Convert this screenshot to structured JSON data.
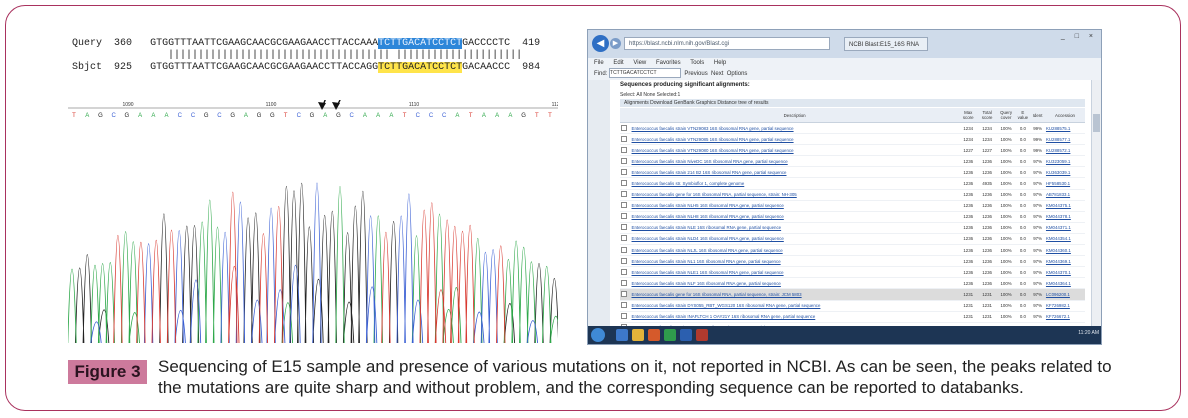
{
  "alignment": {
    "query_label": "Query",
    "query_start": "360",
    "query_seq_a": "GTGGTTTAATTCGAAGCAACGCGAAGAACCTTACCAAA",
    "query_seq_hl": "TCTTGACATCCTCT",
    "query_seq_b": "GACCCCTC",
    "query_end": "419",
    "match_line": "||||||||||||||||||||||||||||||||||||| |||||||||||||||||||||",
    "sbjct_label": "Sbjct",
    "sbjct_start": "925",
    "sbjct_seq_a": "GTGGTTTAATTCGAAGCAACGCGAAGAACCTTACCAGG",
    "sbjct_seq_hl": "TCTTGACATCCTCT",
    "sbjct_seq_b": "GACAACCC",
    "sbjct_end": "984"
  },
  "chromatogram": {
    "positions": [
      "1090",
      "1100",
      "1110",
      "1120"
    ],
    "bases": "TAGCGAAACCGCGAGGTCGAGCAAATCCCATAAAGTT",
    "base_colors": {
      "A": "#2ea84a",
      "C": "#3a5fd4",
      "G": "#222222",
      "T": "#d8382f"
    }
  },
  "browser": {
    "url": "https://blast.ncbi.nlm.nih.gov/Blast.cgi",
    "tab": "NCBI Blast:E15_16S RNA",
    "window_controls": "_ □ ×",
    "menu": [
      "File",
      "Edit",
      "View",
      "Favorites",
      "Tools",
      "Help"
    ],
    "find_label": "Find:",
    "find_value": "TCTTGACATCCTCT",
    "find_prev": "Previous",
    "find_next": "Next",
    "find_options": "Options",
    "section_title": "Sequences producing significant alignments:",
    "select_line": "Select: All None  Selected:1",
    "toolbar": "Alignments  Download  GenBank  Graphics  Distance tree of results",
    "columns": [
      "",
      "Description",
      "Max score",
      "Total score",
      "Query cover",
      "E value",
      "Ident",
      "Accession"
    ],
    "rows": [
      [
        "Enterococcus faecalis strain VTN29083 16S ribosomal RNA gene, partial sequence",
        "1234",
        "1234",
        "100%",
        "0.0",
        "99%",
        "KU288575.1"
      ],
      [
        "Enterococcus faecalis strain VTN29085 16S ribosomal RNA gene, partial sequence",
        "1234",
        "1234",
        "100%",
        "0.0",
        "99%",
        "KU288577.1"
      ],
      [
        "Enterococcus faecalis strain VTN29080 16S ribosomal RNA gene, partial sequence",
        "1227",
        "1227",
        "100%",
        "0.0",
        "99%",
        "KU288572.1"
      ],
      [
        "Enterococcus faecalis strain NiveDC 16S ribosomal RNA gene, partial sequence",
        "1236",
        "1236",
        "100%",
        "0.0",
        "97%",
        "KU323059.1"
      ],
      [
        "Enterococcus faecalis strain 214 B2 16S ribosomal RNA gene, partial sequence",
        "1236",
        "1236",
        "100%",
        "0.0",
        "97%",
        "KU363039.1"
      ],
      [
        "Enterococcus faecalis str. Symbioflor 1, complete genome",
        "1236",
        "4935",
        "100%",
        "0.0",
        "97%",
        "HF558530.1"
      ],
      [
        "Enterococcus faecalis gene for 16S ribosomal RNA, partial sequence, strain: NH-305",
        "1236",
        "1236",
        "100%",
        "0.0",
        "97%",
        "AB781833.1"
      ],
      [
        "Enterococcus faecalis strain NLH5 16S ribosomal RNA gene, partial sequence",
        "1236",
        "1236",
        "100%",
        "0.0",
        "97%",
        "KM044375.1"
      ],
      [
        "Enterococcus faecalis strain NLH8 16S ribosomal RNA gene, partial sequence",
        "1236",
        "1236",
        "100%",
        "0.0",
        "97%",
        "KM044378.1"
      ],
      [
        "Enterococcus faecalis strain NLE 16S ribosomal RNA gene, partial sequence",
        "1236",
        "1236",
        "100%",
        "0.0",
        "97%",
        "KM044371.1"
      ],
      [
        "Enterococcus faecalis strain NLD4 16S ribosomal RNA gene, partial sequence",
        "1236",
        "1236",
        "100%",
        "0.0",
        "97%",
        "KM044354.1"
      ],
      [
        "Enterococcus faecalis strain NLJL 16S ribosomal RNA gene, partial sequence",
        "1236",
        "1236",
        "100%",
        "0.0",
        "97%",
        "KM044360.1"
      ],
      [
        "Enterococcus faecalis strain NL1 16S ribosomal RNA gene, partial sequence",
        "1236",
        "1236",
        "100%",
        "0.0",
        "97%",
        "KM044369.1"
      ],
      [
        "Enterococcus faecalis strain NLE1 16S ribosomal RNA gene, partial sequence",
        "1236",
        "1236",
        "100%",
        "0.0",
        "97%",
        "KM044370.1"
      ],
      [
        "Enterococcus faecalis strain NLF 16S ribosomal RNA gene, partial sequence",
        "1236",
        "1236",
        "100%",
        "0.0",
        "97%",
        "KM044364.1"
      ],
      [
        "Enterococcus faecalis gene for 16S ribosomal RNA, partial sequence, strain: JCM 5803",
        "1231",
        "1231",
        "100%",
        "0.0",
        "97%",
        "LC096200.1"
      ],
      [
        "Enterococcus faecalis strain DYS055_RBT_WGS120 16S ribosomal RNA gene, partial sequence",
        "1231",
        "1231",
        "100%",
        "0.0",
        "97%",
        "KF726982.1"
      ],
      [
        "Enterococcus faecalis strain INAFLTCH 1 OAY21Y 16S ribosomal RNA gene, partial sequence",
        "1231",
        "1231",
        "100%",
        "0.0",
        "97%",
        "KF726672.1"
      ],
      [
        "Enterococcus faecalis strain VNW9 16S ribosomal RNA gene, partial sequence",
        "1231",
        "1231",
        "100%",
        "0.0",
        "97%",
        "KP148581.1"
      ]
    ],
    "selected_row": 15,
    "clock": "11:20 AM"
  },
  "figure": {
    "label": "Figure 3",
    "caption": "Sequencing of E15 sample and presence of various mutations on it, not reported in NCBI. As can be seen, the peaks related to the mutations are quite sharp and without problem, and the corresponding sequence can be reported to databanks."
  }
}
